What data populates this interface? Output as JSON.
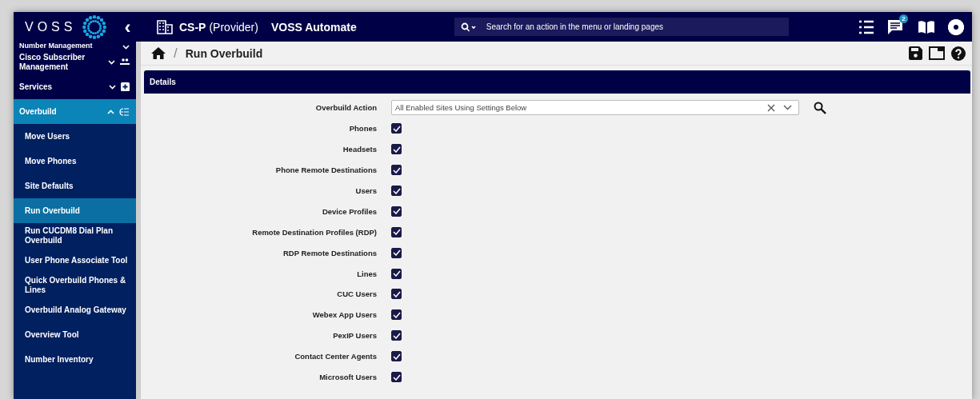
{
  "header": {
    "logo": "VOSS",
    "collapse": "‹",
    "tenant": "CS-P",
    "tenant_role": "(Provider)",
    "product": "VOSS Automate",
    "search": {
      "placeholder": "Search for an action in the menu or landing pages"
    },
    "notifications": "2"
  },
  "sidebar": {
    "items": [
      {
        "label": "Number Management",
        "expanded": false,
        "selected": false
      },
      {
        "label": "Cisco Subscriber Management",
        "expanded": false,
        "selected": false
      },
      {
        "label": "Services",
        "expanded": false,
        "selected": false
      },
      {
        "label": "Overbuild",
        "expanded": true,
        "selected": true,
        "children": [
          {
            "label": "Move Users",
            "selected": false
          },
          {
            "label": "Move Phones",
            "selected": false
          },
          {
            "label": "Site Defaults",
            "selected": false
          },
          {
            "label": "Run Overbuild",
            "selected": true
          },
          {
            "label": "Run CUCDM8 Dial Plan Overbuild",
            "selected": false
          },
          {
            "label": "User Phone Associate Tool",
            "selected": false
          },
          {
            "label": "Quick Overbuild Phones & Lines",
            "selected": false
          },
          {
            "label": "Overbuild Analog Gateway",
            "selected": false
          },
          {
            "label": "Overview Tool",
            "selected": false
          },
          {
            "label": "Number Inventory",
            "selected": false
          }
        ]
      }
    ]
  },
  "breadcrumb": {
    "separator": "/",
    "title": "Run Overbuild"
  },
  "panel": {
    "title": "Details",
    "action": {
      "label": "Overbuild Action",
      "value": "All Enabled Sites Using Settings Below"
    },
    "options": [
      {
        "label": "Phones",
        "checked": true
      },
      {
        "label": "Headsets",
        "checked": true
      },
      {
        "label": "Phone Remote Destinations",
        "checked": true
      },
      {
        "label": "Users",
        "checked": true
      },
      {
        "label": "Device Profiles",
        "checked": true
      },
      {
        "label": "Remote Destination Profiles (RDP)",
        "checked": true
      },
      {
        "label": "RDP Remote Destinations",
        "checked": true
      },
      {
        "label": "Lines",
        "checked": true
      },
      {
        "label": "CUC Users",
        "checked": true
      },
      {
        "label": "Webex App Users",
        "checked": true
      },
      {
        "label": "PexIP Users",
        "checked": true
      },
      {
        "label": "Contact Center Agents",
        "checked": true
      },
      {
        "label": "Microsoft Users",
        "checked": true
      }
    ]
  }
}
